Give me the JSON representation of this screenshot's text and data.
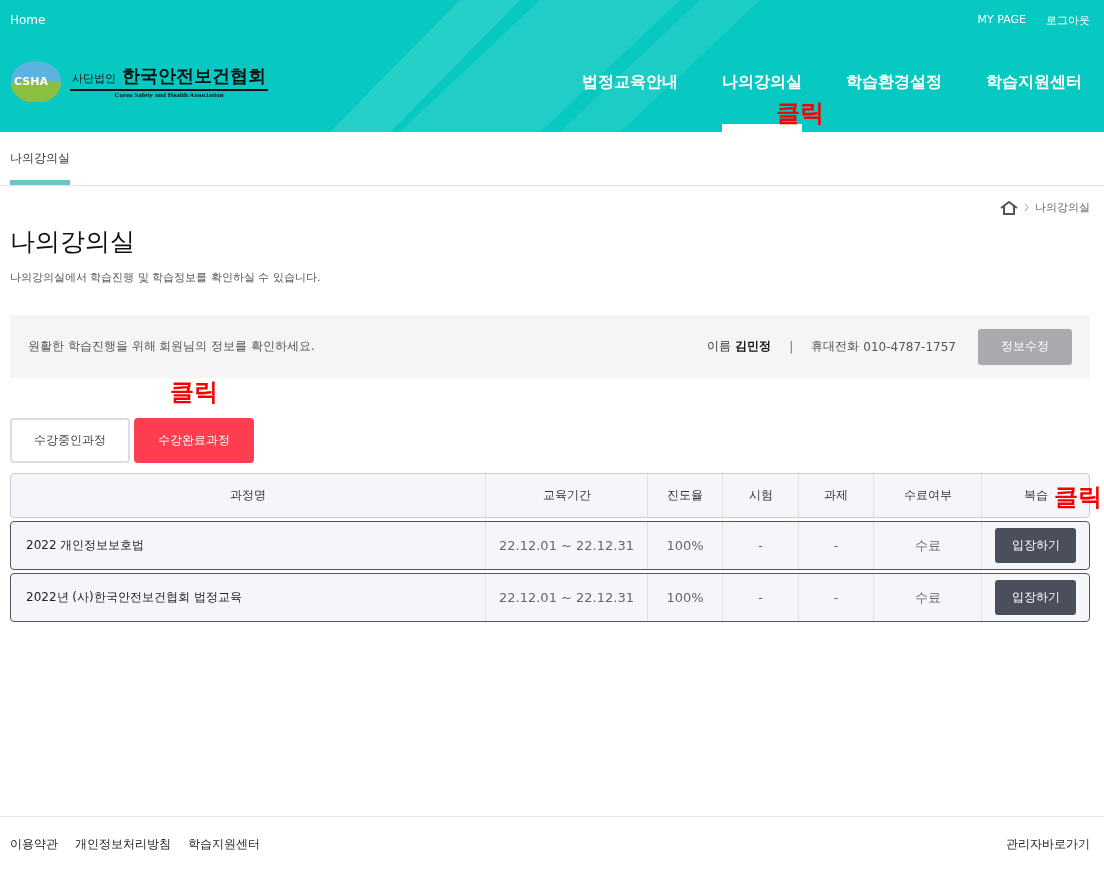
{
  "top_bar": {
    "home": "Home",
    "links": [
      "MY PAGE",
      "로그아웃"
    ]
  },
  "logo": {
    "badge": "CSHA",
    "prefix": "사단법인",
    "name": "한국안전보건협회",
    "english": "Corea Safety and Health Association"
  },
  "nav": [
    {
      "label": "법정교육안내",
      "selected": false
    },
    {
      "label": "나의강의실",
      "selected": true
    },
    {
      "label": "학습환경설정",
      "selected": false
    },
    {
      "label": "학습지원센터",
      "selected": false
    }
  ],
  "sub_tabs": [
    {
      "label": "나의강의실",
      "selected": true
    }
  ],
  "breadcrumb": [
    "나의강의실"
  ],
  "page": {
    "title": "나의강의실",
    "description": "나의강의실에서 학습진행 및 학습정보를 확인하실 수 있습니다."
  },
  "info_box": {
    "message": "원활한 학습진행을 위해 회원님의 정보를 확인하세요.",
    "name_label": "이름",
    "name": "김민정",
    "separator": "|",
    "phone_label": "휴대전화",
    "phone": "010-4787-1757",
    "button": "정보수정"
  },
  "course_tabs": [
    {
      "label": "수강중인과정",
      "selected": false
    },
    {
      "label": "수강완료과정",
      "selected": true
    }
  ],
  "table": {
    "columns": [
      "과정명",
      "교육기간",
      "진도율",
      "시험",
      "과제",
      "수료여부",
      "복습"
    ],
    "rows": [
      {
        "cells": [
          "2022 개인정보보호법",
          "22.12.01 ~ 22.12.31",
          "100%",
          "-",
          "-",
          "수료"
        ],
        "button": "입장하기"
      },
      {
        "cells": [
          "2022년 (사)한국안전보건협회 법정교육",
          "22.12.01 ~ 22.12.31",
          "100%",
          "-",
          "-",
          "수료"
        ],
        "button": "입장하기"
      }
    ]
  },
  "footer": {
    "links": [
      "이용약관",
      "개인정보처리방침",
      "학습지원센터"
    ],
    "admin": "관리자바로가기"
  },
  "annotations": [
    {
      "text": "클릭"
    },
    {
      "text": "클릭"
    },
    {
      "text": "클릭"
    }
  ]
}
